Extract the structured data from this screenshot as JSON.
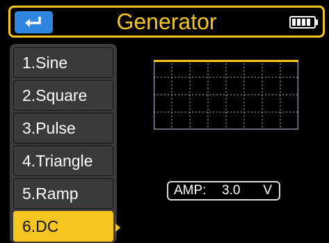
{
  "header": {
    "title": "Generator",
    "back_icon": "return-arrow-icon",
    "battery_icon": "battery-icon",
    "accent_color": "#f7c520",
    "back_color": "#2f86de"
  },
  "menu": {
    "items": [
      {
        "label": "1.Sine"
      },
      {
        "label": "2.Square"
      },
      {
        "label": "3.Pulse"
      },
      {
        "label": "4.Triangle"
      },
      {
        "label": "5.Ramp"
      },
      {
        "label": "6.DC",
        "selected": true
      }
    ]
  },
  "preview": {
    "waveform": "dc",
    "level": 1.0
  },
  "amp": {
    "label": "AMP:",
    "value": "3.0",
    "unit": "V"
  }
}
